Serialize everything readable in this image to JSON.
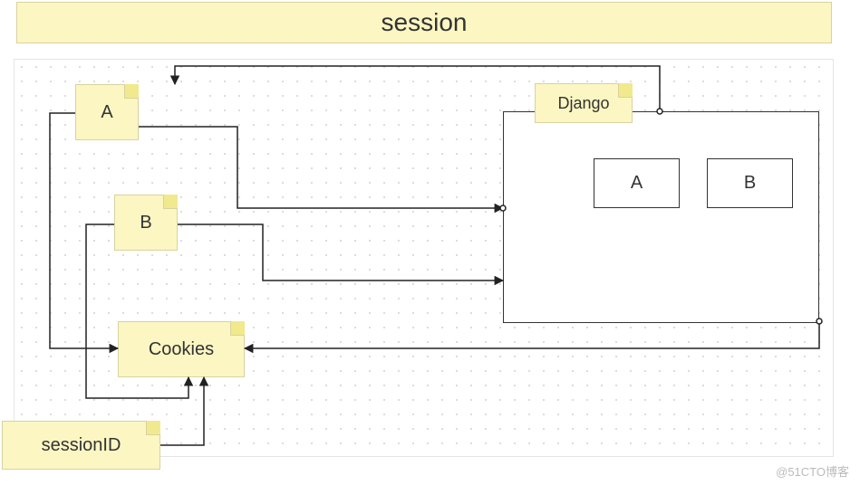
{
  "title": "session",
  "notes": {
    "a": "A",
    "b": "B",
    "cookies": "Cookies",
    "django": "Django",
    "sessionid": "sessionID"
  },
  "server_boxes": {
    "a": "A",
    "b": "B"
  },
  "watermark": "@51CTO博客",
  "colors": {
    "note_bg": "#fcf6c3",
    "note_fold": "#f1e98d",
    "note_border": "#d8d2a0",
    "line": "#222"
  }
}
